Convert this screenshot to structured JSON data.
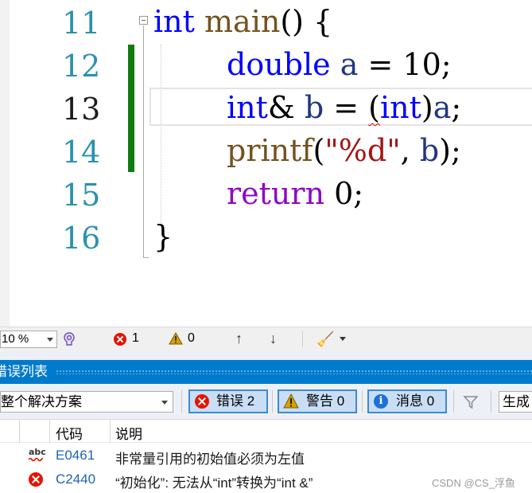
{
  "editor": {
    "line_numbers": [
      "11",
      "12",
      "13",
      "14",
      "15",
      "16"
    ],
    "current_line_index": 2,
    "code": {
      "l11": {
        "kw": "int",
        "fn": "main",
        "rest": "() {"
      },
      "l12": {
        "kw": "double",
        "var": "a",
        "rest1": " = 10;"
      },
      "l13": {
        "kw": "int",
        "rest1": "& ",
        "var_b": "b",
        "rest2": " = ",
        "squiggle": "(",
        "kw2": "int",
        "rest3": ")",
        "var_a": "a",
        "rest4": ";"
      },
      "l14": {
        "fn": "printf",
        "rest1": "(",
        "str": "\"%d\"",
        "rest2": ", ",
        "var": "b",
        "rest3": ");"
      },
      "l15": {
        "kw": "return",
        "rest1": " 0;"
      },
      "l16": {
        "rest1": "}"
      }
    }
  },
  "status_bar": {
    "zoom": "10 %",
    "error_count": "1",
    "warning_count": "0",
    "up_arrow": "↑",
    "down_arrow": "↓"
  },
  "error_list": {
    "title": "错误列表",
    "scope": "整个解决方案",
    "filter_errors": "错误 2",
    "filter_warnings": "警告 0",
    "filter_messages": "消息 0",
    "build_label": "生成",
    "columns": {
      "code": "代码",
      "description": "说明"
    },
    "rows": [
      {
        "icon": "spelling-error-icon",
        "code": "E0461",
        "description": "非常量引用的初始值必须为左值"
      },
      {
        "icon": "error-icon",
        "code": "C2440",
        "description": "“初始化”: 无法从“int”转换为“int &”"
      }
    ]
  },
  "watermark": "CSDN @CS_浮鱼",
  "colors": {
    "keyword": "#0000ff",
    "control_keyword": "#8f08c4",
    "function": "#74531f",
    "variable": "#1f377f",
    "string": "#a31515",
    "line_number": "#2b91af",
    "change_bar": "#107c10",
    "panel_title_bg": "#007acc",
    "error_red": "#e51400"
  }
}
